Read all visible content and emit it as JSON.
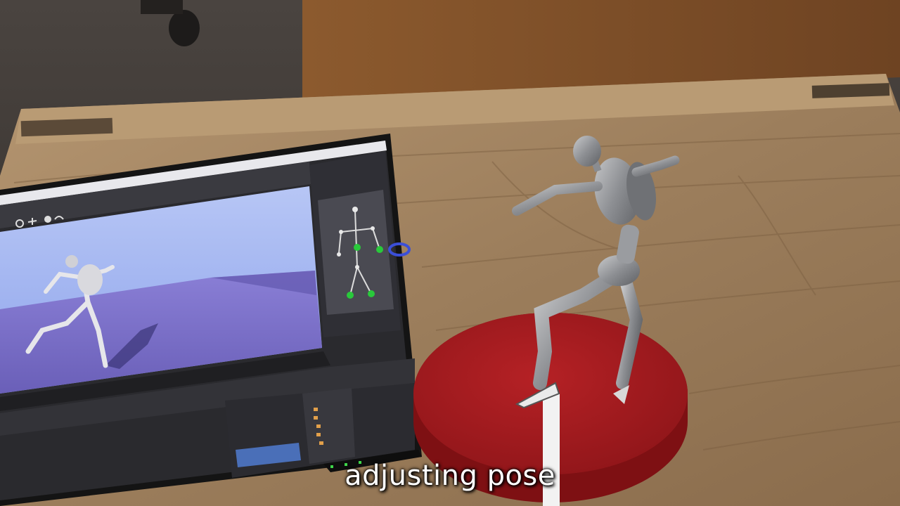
{
  "caption": "adjusting pose",
  "colors": {
    "table_wood": "#a88a66",
    "laptop_frame": "#151515",
    "viewport_sky": "#9eb4f0",
    "viewport_floor": "#7b73c8",
    "turntable_red": "#a81c20",
    "figure_gray": "#8f9194",
    "joint_green": "#29c93b",
    "gizmo_blue": "#3b4fd8"
  },
  "icons": [
    "ring-gizmo-icon",
    "toolbar-icons"
  ]
}
